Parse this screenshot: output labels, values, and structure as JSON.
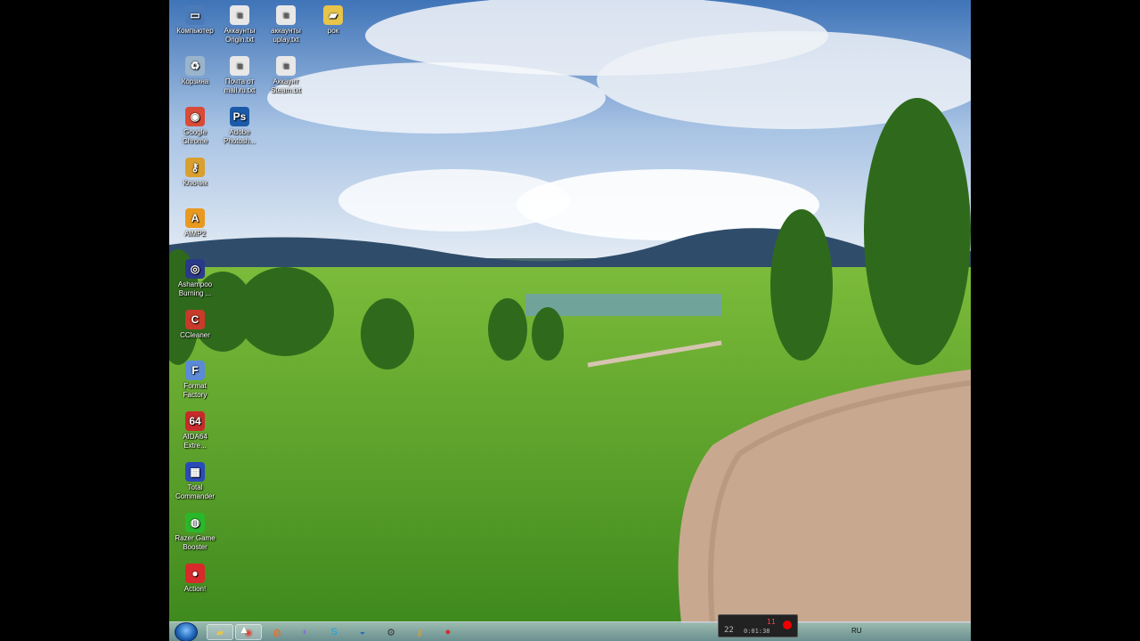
{
  "desktop": {
    "icons": [
      {
        "label": "Компьютер",
        "icon": "computer-icon",
        "color": "#4a7ab8"
      },
      {
        "label": "Аккаунты Origin.txt",
        "icon": "text-file-icon",
        "color": "#e8e8e8"
      },
      {
        "label": "аккаунты uplay.txt",
        "icon": "text-file-icon",
        "color": "#e8e8e8"
      },
      {
        "label": "рок",
        "icon": "folder-icon",
        "color": "#e8c44a"
      },
      {
        "label": "Корзина",
        "icon": "recycle-bin-icon",
        "color": "#9ab4cc"
      },
      {
        "label": "Почта от mail.ru.txt",
        "icon": "text-file-icon",
        "color": "#e8e8e8"
      },
      {
        "label": "Аккаунт Steam.txt",
        "icon": "text-file-icon",
        "color": "#e8e8e8"
      },
      {
        "label": "Google Chrome",
        "icon": "chrome-icon",
        "color": "#d94a38"
      },
      {
        "label": "Adobe Photosh...",
        "icon": "photoshop-icon",
        "color": "#1b5aa8"
      },
      {
        "label": "Ключик",
        "icon": "key-icon",
        "color": "#d9a030"
      },
      {
        "label": "AIMP2",
        "icon": "aimp-icon",
        "color": "#e89a20"
      },
      {
        "label": "Ashampoo Burning ...",
        "icon": "ashampoo-icon",
        "color": "#2a3a8a"
      },
      {
        "label": "CCleaner",
        "icon": "ccleaner-icon",
        "color": "#c83a2a"
      },
      {
        "label": "Format Factory",
        "icon": "format-factory-icon",
        "color": "#5a8ad8"
      },
      {
        "label": "AIDA64 Extre...",
        "icon": "aida64-icon",
        "color": "#c82a2a"
      },
      {
        "label": "Total Commander",
        "icon": "total-commander-icon",
        "color": "#2a4ab8"
      },
      {
        "label": "Razer Game Booster",
        "icon": "razer-icon",
        "color": "#2ab82a"
      },
      {
        "label": "Action!",
        "icon": "action-icon",
        "color": "#d82a2a"
      }
    ]
  },
  "taskbar": {
    "buttons": [
      {
        "icon": "explorer-icon",
        "color": "#e8c44a"
      },
      {
        "icon": "chrome-icon",
        "color": "#d94a38"
      },
      {
        "icon": "origin-icon",
        "color": "#f06a20"
      },
      {
        "icon": "uplay-icon",
        "color": "#8a6ad8"
      },
      {
        "icon": "skype-icon",
        "color": "#1aa0e0"
      },
      {
        "icon": "globe-icon",
        "color": "#2a6ab8"
      },
      {
        "icon": "steam-icon",
        "color": "#3a3a3a"
      },
      {
        "icon": "key-icon",
        "color": "#d9a030"
      },
      {
        "icon": "action-record-icon",
        "color": "#d82a2a"
      }
    ],
    "language": "RU"
  },
  "recorder": {
    "fps": "22",
    "time": "0:01:38",
    "count": "11"
  }
}
